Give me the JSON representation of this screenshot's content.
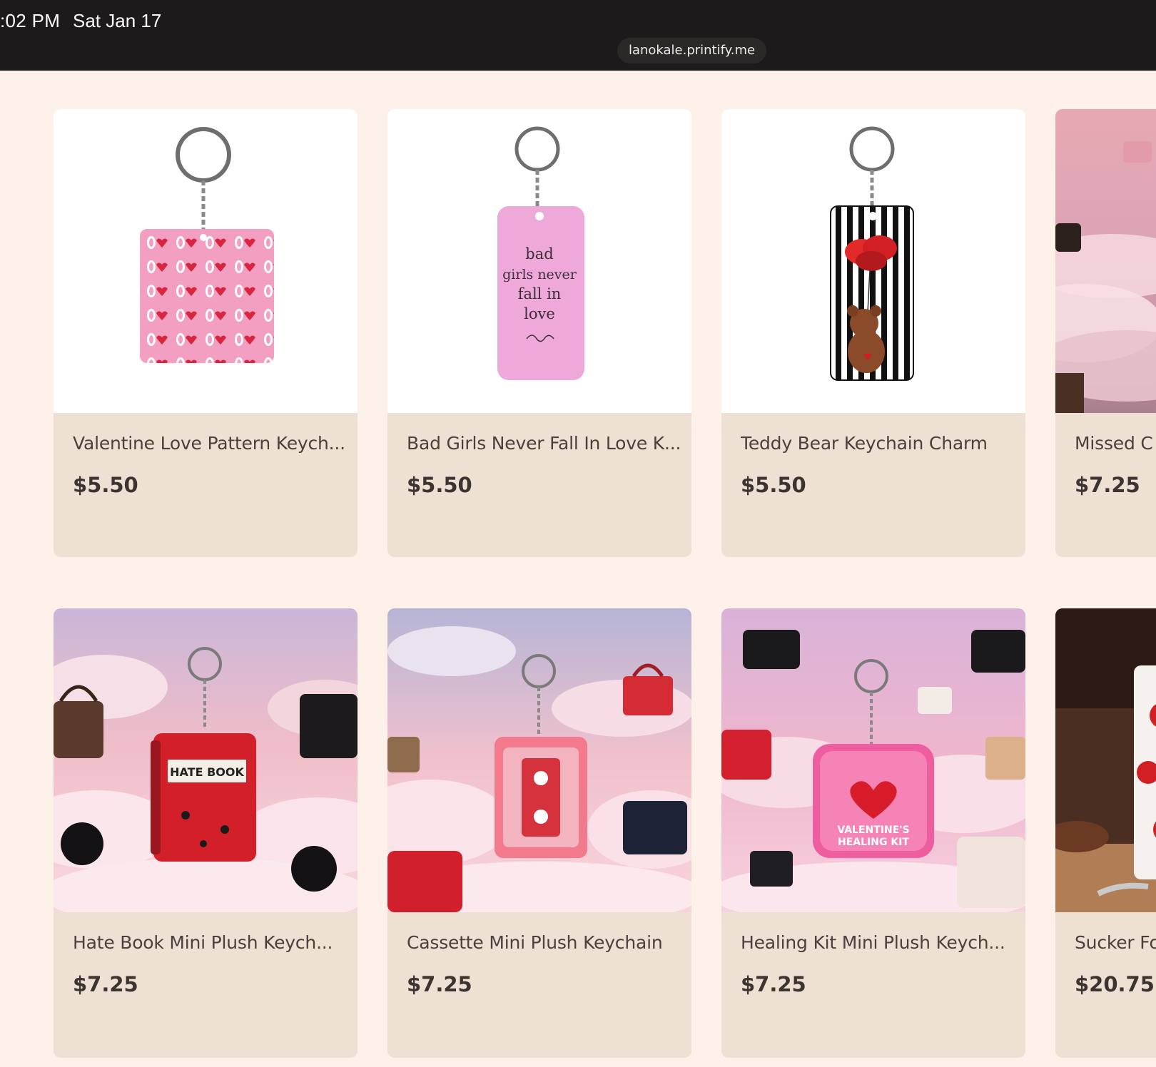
{
  "status_bar": {
    "time": ":02 PM",
    "date": "Sat Jan 17"
  },
  "browser": {
    "url": "lanokale.printify.me"
  },
  "products": [
    {
      "title": "Valentine Love Pattern Keych...",
      "price": "$5.50",
      "image_icon": "keychain-love-pattern-icon"
    },
    {
      "title": "Bad Girls Never Fall In Love K...",
      "price": "$5.50",
      "image_icon": "keychain-bad-girls-icon",
      "image_text": [
        "bad",
        "girls never",
        "fall in",
        "love"
      ]
    },
    {
      "title": "Teddy Bear Keychain Charm",
      "price": "$5.50",
      "image_icon": "keychain-teddy-bear-icon"
    },
    {
      "title": "Missed C",
      "price": "$7.25",
      "image_icon": "clouds-handbags-icon"
    },
    {
      "title": "Hate Book Mini Plush Keych...",
      "price": "$7.25",
      "image_icon": "hate-book-keychain-icon",
      "image_text": [
        "HATE BOOK"
      ]
    },
    {
      "title": "Cassette Mini Plush Keychain",
      "price": "$7.25",
      "image_icon": "cassette-keychain-icon"
    },
    {
      "title": "Healing Kit Mini Plush Keych...",
      "price": "$7.25",
      "image_icon": "healing-kit-keychain-icon",
      "image_text": [
        "VALENTINE'S",
        "HEALING KIT"
      ]
    },
    {
      "title": "Sucker Fo",
      "price": "$20.75",
      "image_icon": "mug-photo-icon"
    }
  ]
}
